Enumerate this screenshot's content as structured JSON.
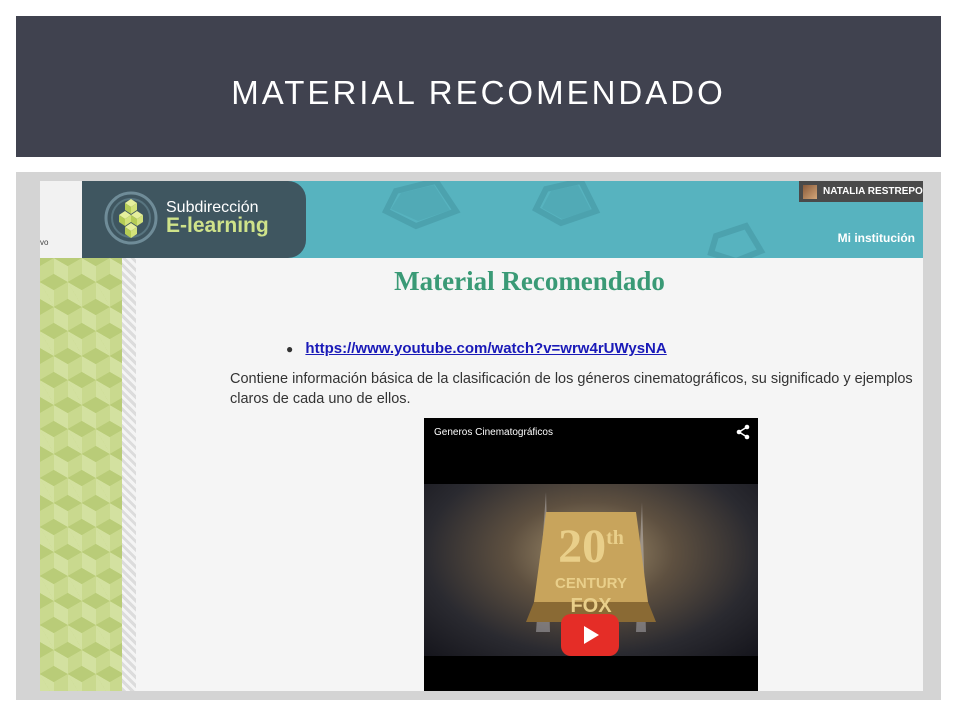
{
  "slide": {
    "title": "MATERIAL RECOMENDADO"
  },
  "site": {
    "header_left_text": "vo",
    "logo": {
      "line1": "Subdirección",
      "line2": "E-learning"
    },
    "user": {
      "name": "NATALIA RESTREPO AG"
    },
    "nav": {
      "mi_institucion": "Mi institución"
    }
  },
  "content": {
    "heading": "Material Recomendado",
    "link_url": "https://www.youtube.com/watch?v=wrw4rUWysNA",
    "description": "Contiene información básica de la clasificación de los géneros cinematográficos, su significado y ejemplos claros de cada uno de ellos.",
    "video": {
      "title": "Generos Cinematográficos",
      "thumbnail_text": "20th CENTURY FOX"
    }
  },
  "colors": {
    "banner": "#40424f",
    "header_teal": "#57b3bf",
    "logo_panel": "#3f5660",
    "heading_green": "#3a9a76",
    "link_blue": "#1a1ab8",
    "play_red": "#e52d27"
  },
  "icons": [
    "logo-cube-icon",
    "share-icon",
    "play-icon"
  ]
}
